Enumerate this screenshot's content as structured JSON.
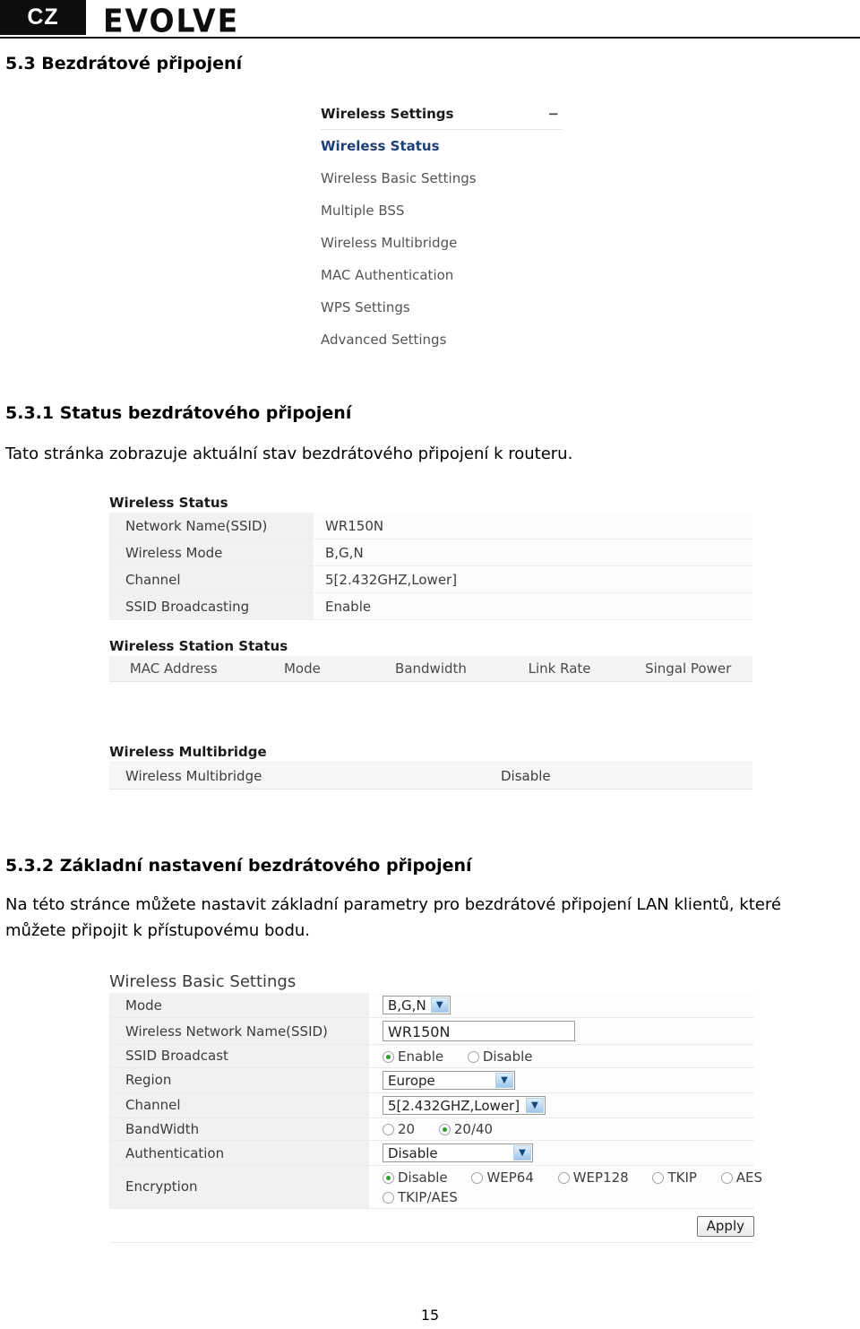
{
  "header": {
    "locale_badge": "CZ",
    "brand": "EVOLVE"
  },
  "sections": {
    "s53_heading": "5.3 Bezdrátové připojení",
    "s531_heading": "5.3.1 Status bezdrátového připojení",
    "s531_paragraph": "Tato stránka zobrazuje aktuální stav bezdrátového připojení k routeru.",
    "s532_heading": "5.3.2 Základní nastavení bezdrátového připojení",
    "s532_paragraph": "Na této stránce můžete nastavit základní parametry pro bezdrátové připojení LAN klientů, které můžete připojit k přístupovému bodu."
  },
  "menu": {
    "title": "Wireless Settings",
    "collapse_icon": "−",
    "items": [
      {
        "label": "Wireless Status",
        "active": true
      },
      {
        "label": "Wireless Basic Settings",
        "active": false
      },
      {
        "label": "Multiple BSS",
        "active": false
      },
      {
        "label": "Wireless Multibridge",
        "active": false
      },
      {
        "label": "MAC Authentication",
        "active": false
      },
      {
        "label": "WPS Settings",
        "active": false
      },
      {
        "label": "Advanced Settings",
        "active": false
      }
    ]
  },
  "wireless_status": {
    "title": "Wireless Status",
    "rows": [
      {
        "label": "Network Name(SSID)",
        "value": "WR150N"
      },
      {
        "label": "Wireless Mode",
        "value": "B,G,N"
      },
      {
        "label": "Channel",
        "value": "5[2.432GHZ,Lower]"
      },
      {
        "label": "SSID Broadcasting",
        "value": "Enable"
      }
    ]
  },
  "station_status": {
    "title": "Wireless Station Status",
    "columns": [
      "MAC Address",
      "Mode",
      "Bandwidth",
      "Link Rate",
      "Singal Power"
    ],
    "rows": []
  },
  "multibridge": {
    "title": "Wireless Multibridge",
    "row": {
      "label": "Wireless Multibridge",
      "value": "Disable"
    }
  },
  "basic_settings": {
    "title": "Wireless Basic Settings",
    "mode": {
      "label": "Mode",
      "value": "B,G,N"
    },
    "ssid": {
      "label": "Wireless Network Name(SSID)",
      "value": "WR150N"
    },
    "ssid_broadcast": {
      "label": "SSID Broadcast",
      "options": [
        {
          "label": "Enable",
          "selected": true
        },
        {
          "label": "Disable",
          "selected": false
        }
      ]
    },
    "region": {
      "label": "Region",
      "value": "Europe"
    },
    "channel": {
      "label": "Channel",
      "value": "5[2.432GHZ,Lower]"
    },
    "bandwidth": {
      "label": "BandWidth",
      "options": [
        {
          "label": "20",
          "selected": false
        },
        {
          "label": "20/40",
          "selected": true
        }
      ]
    },
    "authentication": {
      "label": "Authentication",
      "value": "Disable"
    },
    "encryption": {
      "label": "Encryption",
      "options": [
        {
          "label": "Disable",
          "selected": true
        },
        {
          "label": "WEP64",
          "selected": false
        },
        {
          "label": "WEP128",
          "selected": false
        },
        {
          "label": "TKIP",
          "selected": false
        },
        {
          "label": "AES",
          "selected": false
        },
        {
          "label": "TKIP/AES",
          "selected": false
        }
      ]
    },
    "apply_label": "Apply"
  },
  "footer": {
    "page_number": "15"
  },
  "colors": {
    "active_menu": "#1d3f75",
    "radio_selected": "#2f9e2f",
    "header_black": "#0d0d0d"
  }
}
